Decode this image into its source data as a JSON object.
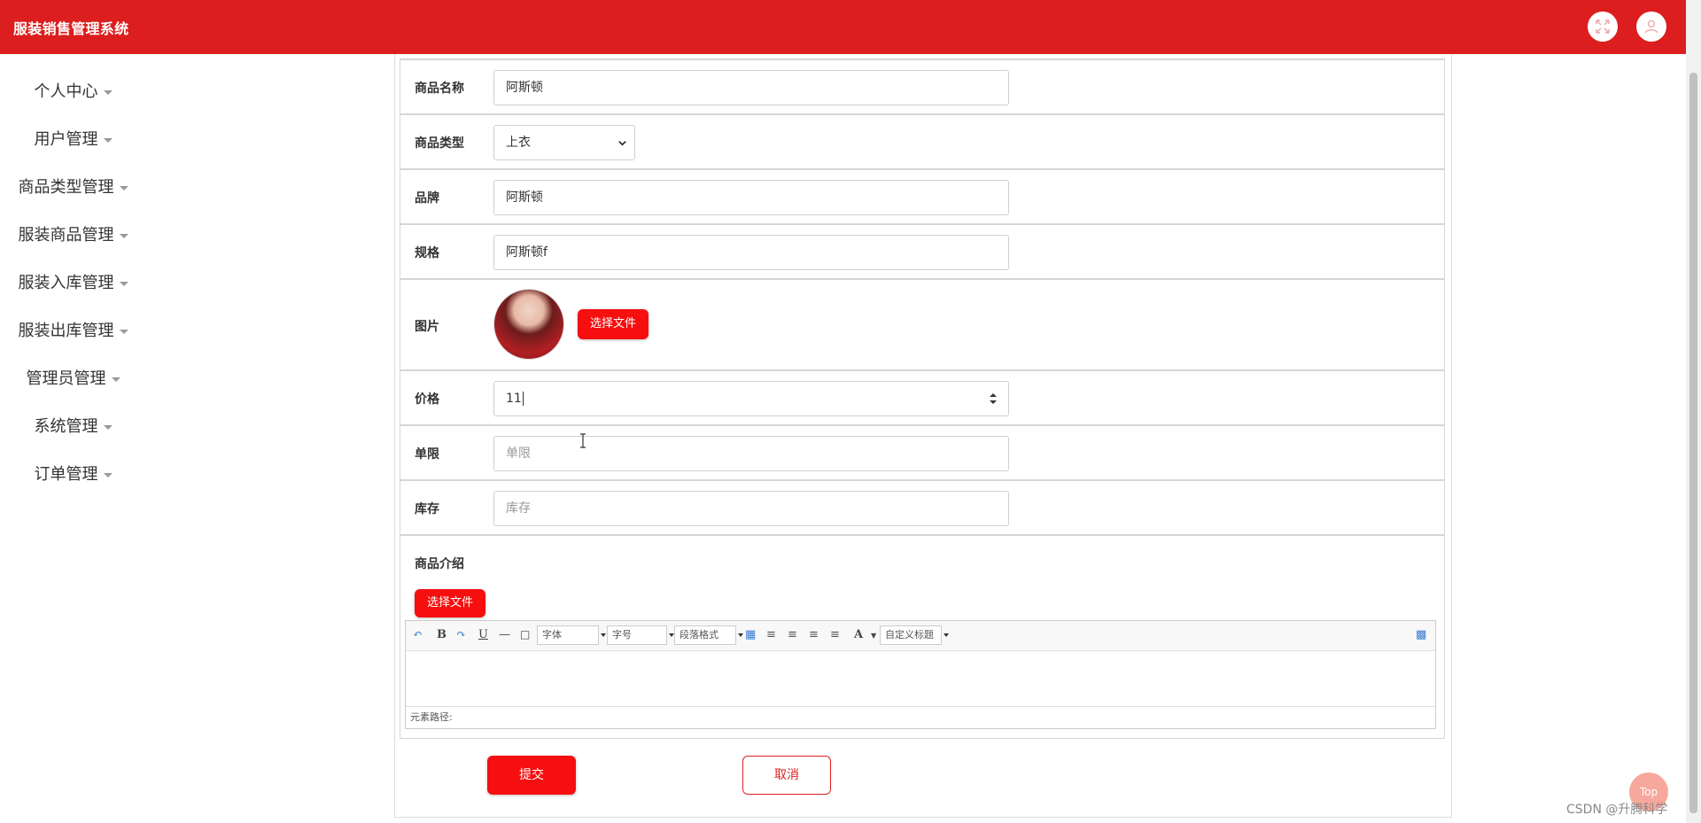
{
  "app": {
    "title": "服装销售管理系统"
  },
  "header_icons": [
    "fullscreen-icon",
    "user-icon"
  ],
  "sidebar": {
    "items": [
      {
        "label": "个人中心"
      },
      {
        "label": "用户管理"
      },
      {
        "label": "商品类型管理"
      },
      {
        "label": "服装商品管理"
      },
      {
        "label": "服装入库管理"
      },
      {
        "label": "服装出库管理"
      },
      {
        "label": "管理员管理"
      },
      {
        "label": "系统管理"
      },
      {
        "label": "订单管理"
      }
    ]
  },
  "form": {
    "name": {
      "label": "商品名称",
      "value": "阿斯顿"
    },
    "type": {
      "label": "商品类型",
      "value": "上衣"
    },
    "brand": {
      "label": "品牌",
      "value": "阿斯顿"
    },
    "spec": {
      "label": "规格",
      "value": "阿斯顿f"
    },
    "image": {
      "label": "图片",
      "button": "选择文件"
    },
    "price": {
      "label": "价格",
      "value": "11"
    },
    "limit": {
      "label": "单限",
      "placeholder": "单限"
    },
    "stock": {
      "label": "库存",
      "placeholder": "库存"
    },
    "intro": {
      "label": "商品介绍",
      "button": "选择文件"
    }
  },
  "editor": {
    "combos": [
      "字体",
      "字号",
      "段落格式",
      "自定义标题"
    ],
    "bold": "B",
    "underline": "U",
    "font_color": "A",
    "path_label": "元素路径:"
  },
  "actions": {
    "submit": "提交",
    "cancel": "取消"
  },
  "top_button": "Top",
  "watermark": "CSDN @升腾科学",
  "colors": {
    "header": "#dc1e1e",
    "primary_button": "#f50f0f"
  }
}
